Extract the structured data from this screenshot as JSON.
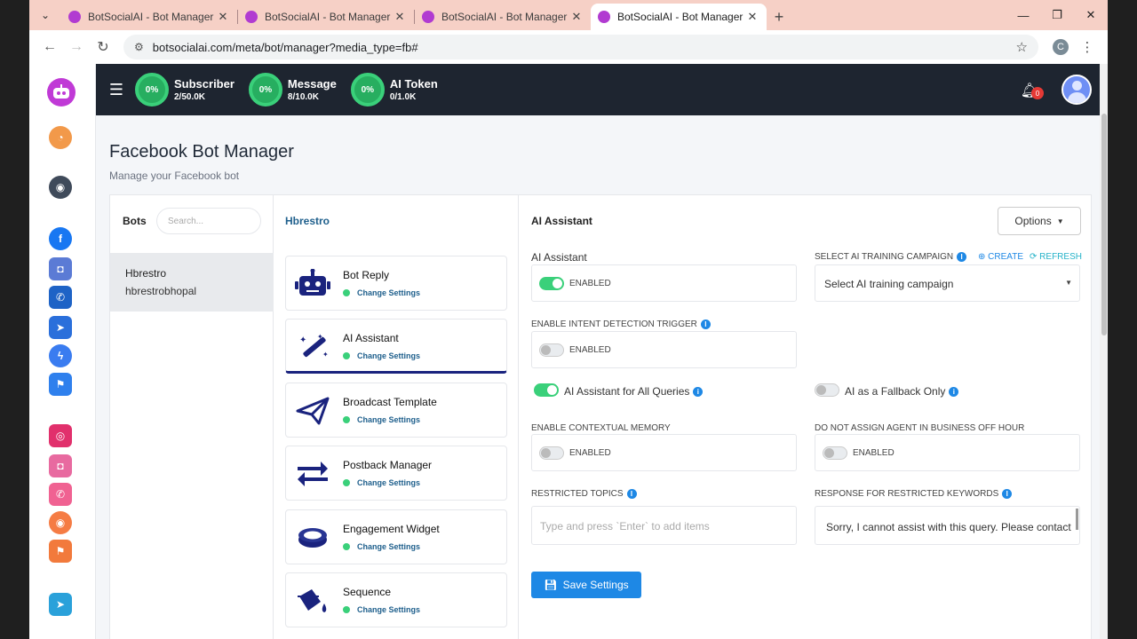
{
  "browser": {
    "tabs": [
      {
        "title": "BotSocialAI - Bot Manager",
        "close": "✕"
      },
      {
        "title": "BotSocialAI - Bot Manager",
        "close": "✕"
      },
      {
        "title": "BotSocialAI - Bot Manager",
        "close": "✕"
      },
      {
        "title": "BotSocialAI - Bot Manager",
        "close": "✕",
        "active": true
      }
    ],
    "new_tab": "+",
    "url": "botsocialai.com/meta/bot/manager?media_type=fb#",
    "profile_letter": "C"
  },
  "topbar": {
    "stats": [
      {
        "percent": "0%",
        "name": "Subscriber",
        "value": "2/50.0K"
      },
      {
        "percent": "0%",
        "name": "Message",
        "value": "8/10.0K"
      },
      {
        "percent": "0%",
        "name": "AI Token",
        "value": "0/1.0K"
      }
    ],
    "notification_count": "0"
  },
  "header": {
    "title": "Facebook Bot Manager",
    "subtitle": "Manage your Facebook bot"
  },
  "bots": {
    "label": "Bots",
    "search_placeholder": "Search...",
    "items": [
      {
        "name": "Hbrestro",
        "username": "hbrestrobhopal"
      }
    ]
  },
  "features": {
    "page_name": "Hbrestro",
    "items": [
      {
        "title": "Bot Reply",
        "link": "Change Settings",
        "icon": "robot-icon"
      },
      {
        "title": "AI Assistant",
        "link": "Change Settings",
        "icon": "magic-wand-icon"
      },
      {
        "title": "Broadcast Template",
        "link": "Change Settings",
        "icon": "paper-plane-icon"
      },
      {
        "title": "Postback Manager",
        "link": "Change Settings",
        "icon": "arrows-exchange-icon"
      },
      {
        "title": "Engagement Widget",
        "link": "Change Settings",
        "icon": "ring-icon"
      },
      {
        "title": "Sequence",
        "link": "Change Settings",
        "icon": "paint-bucket-icon"
      }
    ]
  },
  "settings": {
    "title": "AI Assistant",
    "options_label": "Options",
    "ai_assistant_label": "AI Assistant",
    "ai_assistant_toggle_label": "ENABLED",
    "training_campaign_label": "SELECT AI TRAINING CAMPAIGN",
    "create_label": "CREATE",
    "refresh_label": "REFRESH",
    "training_campaign_value": "Select AI training campaign",
    "intent_label": "ENABLE INTENT DETECTION TRIGGER",
    "intent_toggle_label": "ENABLED",
    "all_queries_label": "AI Assistant for All Queries",
    "fallback_label": "AI as a Fallback Only",
    "memory_label": "ENABLE CONTEXTUAL MEMORY",
    "memory_toggle_label": "ENABLED",
    "off_hour_label": "DO NOT ASSIGN AGENT IN BUSINESS OFF HOUR",
    "off_hour_toggle_label": "ENABLED",
    "restricted_topics_label": "RESTRICTED TOPICS",
    "restricted_topics_placeholder": "Type and press `Enter` to add items",
    "restricted_response_label": "RESPONSE FOR RESTRICTED KEYWORDS",
    "restricted_response_value": "Sorry, I cannot assist with this query. Please contact",
    "save_label": "Save Settings"
  },
  "colors": {
    "accent": "#1e88e5",
    "success": "#3ad07a",
    "topbar": "#1e2530",
    "tabstrip": "#f6d0c6",
    "navy": "#1a237e"
  }
}
